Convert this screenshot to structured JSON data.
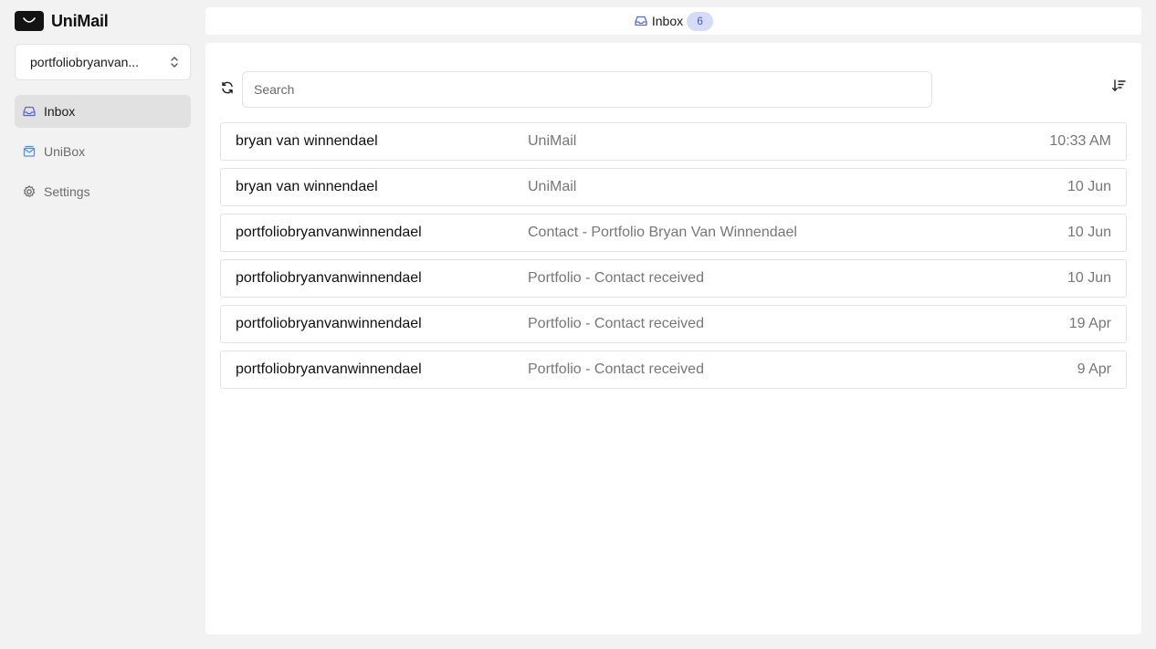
{
  "brand": {
    "name": "UniMail",
    "logo_icon": "inbox-tray-icon"
  },
  "account": {
    "selected": "portfoliobryanvan...",
    "icon": "chevrons-up-down-icon"
  },
  "nav": [
    {
      "label": "Inbox",
      "icon": "inbox-icon",
      "active": true
    },
    {
      "label": "UniBox",
      "icon": "mail-stack-icon",
      "active": false
    },
    {
      "label": "Settings",
      "icon": "gear-icon",
      "active": false
    }
  ],
  "topbar": {
    "title": "Inbox",
    "count": "6",
    "icon": "inbox-icon",
    "badge_bg": "#d6dcf7",
    "badge_fg": "#4a5ac9"
  },
  "search": {
    "placeholder": "Search",
    "value": ""
  },
  "toolbar": {
    "refresh_icon": "refresh-icon",
    "sort_icon": "sort-descending-icon"
  },
  "emails": [
    {
      "sender": "bryan van winnendael",
      "subject": "UniMail",
      "date": "10:33 AM"
    },
    {
      "sender": "bryan van winnendael",
      "subject": "UniMail",
      "date": "10 Jun"
    },
    {
      "sender": "portfoliobryanvanwinnendael",
      "subject": "Contact - Portfolio Bryan Van Winnendael",
      "date": "10 Jun"
    },
    {
      "sender": "portfoliobryanvanwinnendael",
      "subject": "Portfolio - Contact received",
      "date": "10 Jun"
    },
    {
      "sender": "portfoliobryanvanwinnendael",
      "subject": "Portfolio - Contact received",
      "date": "19 Apr"
    },
    {
      "sender": "portfoliobryanvanwinnendael",
      "subject": "Portfolio - Contact received",
      "date": "9 Apr"
    }
  ],
  "colors": {
    "background": "#f2f2f2",
    "panel": "#ffffff",
    "accent": "#5b6bd6",
    "active_nav": "#e1e1e1"
  }
}
